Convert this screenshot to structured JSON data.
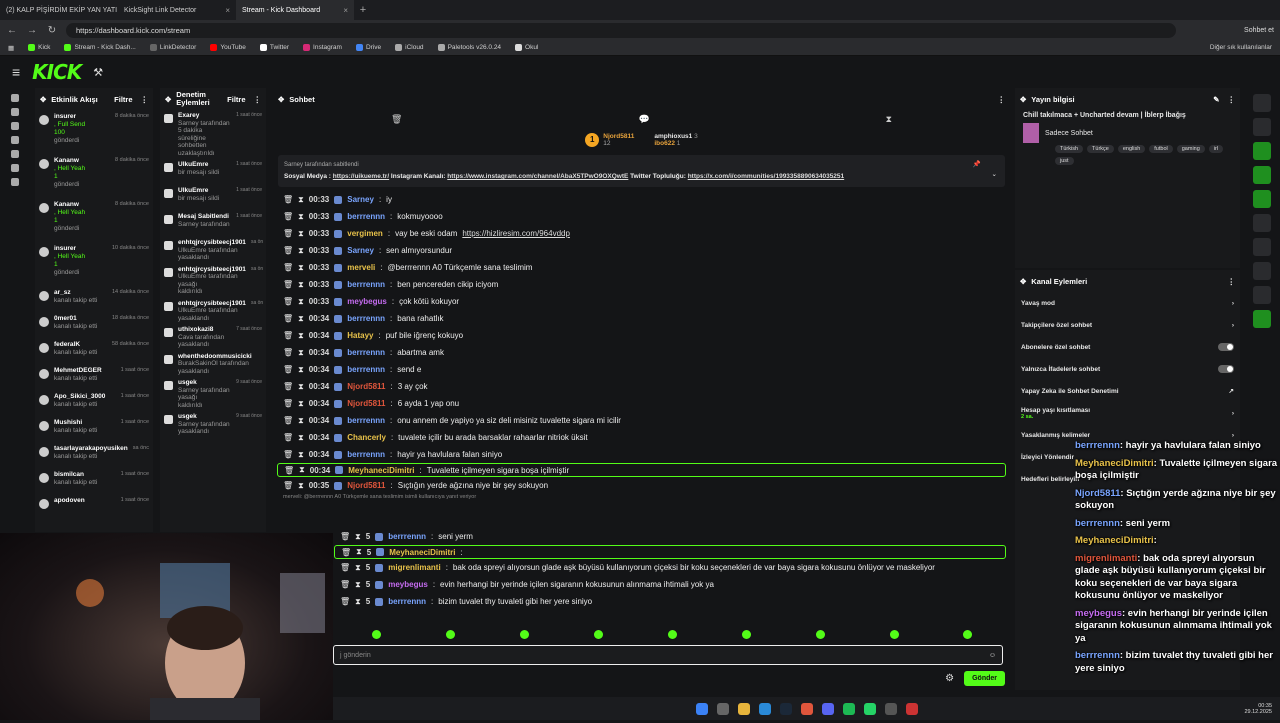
{
  "browser": {
    "tabs": [
      {
        "label": "(2) KALP PİŞİRDİM EKİP YAN YATI",
        "active": false
      },
      {
        "label": "KickSight Link Detector",
        "active": false
      },
      {
        "label": "Stream - Kick Dashboard",
        "active": true
      }
    ],
    "url": "https://dashboard.kick.com/stream",
    "profile_label": "Sohbet et",
    "bookmarks": [
      "Kick",
      "Stream - Kick Dash...",
      "LinkDetector",
      "YouTube",
      "Twitter",
      "Instagram",
      "Drive",
      "iCloud",
      "Paletools v26.0.24",
      "Okul"
    ],
    "other_bookmarks": "Diğer sık kullanılanlar"
  },
  "kick": {
    "logo": "KICK",
    "beta": "BETA"
  },
  "activity": {
    "title": "Etkinlik Akışı",
    "filter": "Filtre",
    "items": [
      {
        "name": "insurer",
        "detail": ", Full Send",
        "extra": "100",
        "action": "gönderdi",
        "time": "8 dakika önce"
      },
      {
        "name": "Kananw",
        "detail": ", Hell Yeah",
        "extra": "1",
        "action": "gönderdi",
        "time": "8 dakika önce"
      },
      {
        "name": "Kananw",
        "detail": ", Hell Yeah",
        "extra": "1",
        "action": "gönderdi",
        "time": "8 dakika önce"
      },
      {
        "name": "insurer",
        "detail": ", Hell Yeah",
        "extra": "1",
        "action": "gönderdi",
        "time": "10 dakika önce"
      },
      {
        "name": "ar_sz",
        "detail": "",
        "extra": "",
        "action": "kanalı takip etti",
        "time": "14 dakika önce"
      },
      {
        "name": "0mer01",
        "detail": "",
        "extra": "",
        "action": "kanalı takip etti",
        "time": "18 dakika önce"
      },
      {
        "name": "federalK",
        "detail": "",
        "extra": "",
        "action": "kanalı takip etti",
        "time": "58 dakika önce"
      },
      {
        "name": "MehmetDEGER",
        "detail": "",
        "extra": "",
        "action": "kanalı takip etti",
        "time": "1 saat önce"
      },
      {
        "name": "Apo_Sikici_3000",
        "detail": "",
        "extra": "",
        "action": "kanalı takip etti",
        "time": "1 saat önce"
      },
      {
        "name": "Mushishi",
        "detail": "",
        "extra": "",
        "action": "kanalı takip etti",
        "time": "1 saat önce"
      },
      {
        "name": "tasarlayarakapoyusiken",
        "detail": "",
        "extra": "",
        "action": "kanalı takip etti",
        "time": "sa önc"
      },
      {
        "name": "bismilcan",
        "detail": "",
        "extra": "",
        "action": "kanalı takip etti",
        "time": "1 saat önce"
      },
      {
        "name": "apodoven",
        "detail": "",
        "extra": "",
        "action": "",
        "time": "1 saat önce"
      }
    ]
  },
  "modlog": {
    "title": "Denetim Eylemleri",
    "filter": "Filtre",
    "items": [
      {
        "name": "Exarey",
        "line1": "Sarney tarafından 5 dakika",
        "line2": "süreliğine sohbetten uzaklaştırıldı",
        "time": "1 saat önce"
      },
      {
        "name": "UlkuEmre",
        "line1": "bir mesajı sildi",
        "line2": "",
        "time": "1 saat önce"
      },
      {
        "name": "UlkuEmre",
        "line1": "bir mesajı sildi",
        "line2": "",
        "time": "1 saat önce"
      },
      {
        "name": "Mesaj Sabitlendi",
        "line1": "Sarney tarafından",
        "line2": "",
        "time": "1 saat önce"
      },
      {
        "name": "enhtqjrcysibteecj1901",
        "line1": "UlkuEmre tarafından",
        "line2": "yasaklandı",
        "time": "sa ön"
      },
      {
        "name": "enhtqjrcysibteecj1901",
        "line1": "UlkuEmre tarafından yasağı",
        "line2": "kaldırıldı",
        "time": "sa ön"
      },
      {
        "name": "enhtqjrcysibteecj1901",
        "line1": "UlkuEmre tarafından",
        "line2": "yasaklandı",
        "time": "sa ön"
      },
      {
        "name": "uthixokazi8",
        "line1": "Cava tarafından yasaklandı",
        "line2": "",
        "time": "7 saat önce"
      },
      {
        "name": "whenthedoommusicicki",
        "line1": "BurakSakinOl tarafından",
        "line2": "yasaklandı",
        "time": ""
      },
      {
        "name": "usgek",
        "line1": "Sarney tarafından yasağı",
        "line2": "kaldırıldı",
        "time": "9 saat önce"
      },
      {
        "name": "usgek",
        "line1": "Sarney tarafından",
        "line2": "yasaklandı",
        "time": "9 saat önce"
      }
    ]
  },
  "chat": {
    "title": "Sohbet",
    "leaderboard": [
      {
        "name": "Njord5811",
        "value": "12"
      },
      {
        "name": "amphioxus1",
        "value": "3"
      },
      {
        "name": "ibo622",
        "value": "1"
      }
    ],
    "pinned": {
      "by": "Sarney tarafından sabitlendi",
      "text1": "Sosyal Medya : ",
      "link1": "https://uikueme.tr/",
      "text2": " Instagram Kanalı: ",
      "link2": "https://www.instagram.com/channel/AbaX5TPwO9OXQwtE",
      "text3": " Twitter Topluluğu: ",
      "link3": "https://x.com/i/communities/1993358890634035251"
    },
    "messages": [
      {
        "time": "00:33",
        "user": "Sarney",
        "color": "#7aa5ff",
        "text": "iy",
        "highlight": false
      },
      {
        "time": "00:33",
        "user": "berrrennn",
        "color": "#7aa5ff",
        "text": "kokmuyoooo",
        "highlight": false
      },
      {
        "time": "00:33",
        "user": "vergimen",
        "color": "#e8c24a",
        "text": "vay be eski odam ",
        "link": "https://hizliresim.com/964vddp",
        "highlight": false
      },
      {
        "time": "00:33",
        "user": "Sarney",
        "color": "#7aa5ff",
        "text": "sen almıyorsundur",
        "highlight": false
      },
      {
        "time": "00:33",
        "user": "merveli",
        "color": "#e8c24a",
        "text": "@berrrennn A0 Türkçemle sana teslimim",
        "highlight": false
      },
      {
        "time": "00:33",
        "user": "berrrennn",
        "color": "#7aa5ff",
        "text": "ben pencereden cikip iciyom",
        "highlight": false
      },
      {
        "time": "00:33",
        "user": "meybegus",
        "color": "#c56cf0",
        "text": "çok kötü kokuyor",
        "highlight": false
      },
      {
        "time": "00:34",
        "user": "berrrennn",
        "color": "#7aa5ff",
        "text": "bana rahatlık",
        "highlight": false
      },
      {
        "time": "00:34",
        "user": "Hatayy",
        "color": "#e8c24a",
        "text": "puf bile iğrenç kokuyo",
        "highlight": false
      },
      {
        "time": "00:34",
        "user": "berrrennn",
        "color": "#7aa5ff",
        "text": "abartma amk",
        "highlight": false
      },
      {
        "time": "00:34",
        "user": "berrrennn",
        "color": "#7aa5ff",
        "text": "send e",
        "highlight": false
      },
      {
        "time": "00:34",
        "user": "Njord5811",
        "color": "#e0563c",
        "text": "3 ay çok",
        "highlight": false
      },
      {
        "time": "00:34",
        "user": "Njord5811",
        "color": "#e0563c",
        "text": "6 ayda 1 yap onu",
        "highlight": false
      },
      {
        "time": "00:34",
        "user": "berrrennn",
        "color": "#7aa5ff",
        "text": "onu annem de yapiyo ya siz deli misiniz tuvalette sigara mi icilir",
        "highlight": false
      },
      {
        "time": "00:34",
        "user": "Chancerly",
        "color": "#e8c24a",
        "text": "tuvalete içilir bu arada barsaklar rahaarlar nitriok üksit",
        "highlight": false
      },
      {
        "time": "00:34",
        "user": "berrrennn",
        "color": "#7aa5ff",
        "text": "hayir ya havlulara falan siniyo",
        "highlight": false
      },
      {
        "time": "00:34",
        "user": "MeyhaneciDimitri",
        "color": "#e8c24a",
        "text": "Tuvalette içilmeyen sigara boşa içilmiştir",
        "highlight": true
      },
      {
        "time": "00:35",
        "user": "Njord5811",
        "color": "#e0563c",
        "text": "Sıçtığın yerde ağzına niye bir şey sokuyon",
        "highlight": false
      }
    ],
    "reply_note": "merveli: @berrrennn A0 Türkçemle sana teslimim isimli kullanıcıya yanıt veriyor",
    "late_messages": [
      {
        "time": "5",
        "user": "berrrennn",
        "color": "#7aa5ff",
        "text": "seni yerm",
        "highlight": false
      },
      {
        "time": "5",
        "user": "MeyhaneciDimitri",
        "color": "#e8c24a",
        "text": "",
        "highlight": true
      },
      {
        "time": "5",
        "user": "migrenlimanti",
        "color": "#e8c24a",
        "text": "bak oda spreyi alıyorsun glade aşk büyüsü kullanıyorum çiçeksi bir koku seçenekleri de var baya sigara kokusunu önlüyor ve maskeliyor",
        "highlight": false
      },
      {
        "time": "5",
        "user": "meybegus",
        "color": "#c56cf0",
        "text": "evin herhangi bir yerinde içilen sigaranın kokusunun alınmama ihtimali yok ya",
        "highlight": false
      },
      {
        "time": "5",
        "user": "berrrennn",
        "color": "#7aa5ff",
        "text": "bizim tuvalet thy tuvaleti gibi her yere siniyo",
        "highlight": false
      }
    ],
    "input_placeholder": "j gönderin",
    "send": "Gönder"
  },
  "stream_info": {
    "title": "Yayın bilgisi",
    "stream_title": "Chill takılmaca + Uncharted devam | İblerp İbağış",
    "category": "Sadece Sohbet",
    "tags": [
      "Türkish",
      "Türkçe",
      "english",
      "futbol",
      "gaming",
      "irl",
      "just"
    ]
  },
  "channel_actions": {
    "title": "Kanal Eylemleri",
    "rows": [
      {
        "label": "Yavaş mod",
        "control": "chevron"
      },
      {
        "label": "Takipçilere özel sohbet",
        "control": "chevron"
      },
      {
        "label": "Abonelere özel sohbet",
        "control": "toggle"
      },
      {
        "label": "Yalnızca İfadelerle sohbet",
        "control": "toggle"
      },
      {
        "label": "Yapay Zeka ile Sohbet Denetimi",
        "control": "link"
      },
      {
        "label": "Hesap yaşı kısıtlaması",
        "sub": "2 sa.",
        "control": "chevron"
      },
      {
        "label": "Yasaklanmış kelimeler",
        "control": "chevron"
      },
      {
        "label": "İzleyici Yönlendir",
        "control": ""
      },
      {
        "label": "Hedefleri belirleyin",
        "control": ""
      }
    ]
  },
  "overlay": [
    {
      "user": "berrrennn",
      "color": "#7aa5ff",
      "text": ": hayir ya havlulara falan siniyo"
    },
    {
      "user": "MeyhaneciDimitri",
      "color": "#e8c24a",
      "text": ": Tuvalette içilmeyen sigara boşa içilmiştir"
    },
    {
      "user": "Njord5811",
      "color": "#7aa5ff",
      "text": ": Sıçtığın yerde ağzına niye bir şey sokuyon"
    },
    {
      "user": "berrrennn",
      "color": "#7aa5ff",
      "text": ": seni yerm"
    },
    {
      "user": "MeyhaneciDimitri",
      "color": "#e8c24a",
      "text": ":"
    },
    {
      "user": "migrenlimanti",
      "color": "#e0563c",
      "text": ": bak oda spreyi alıyorsun glade aşk büyüsü kullanıyorum çiçeksi bir koku seçenekleri de var baya sigara kokusunu önlüyor ve maskeliyor"
    },
    {
      "user": "meybegus",
      "color": "#c56cf0",
      "text": ": evin herhangi bir yerinde içilen sigaranın kokusunun alınmama ihtimali yok ya"
    },
    {
      "user": "berrrennn",
      "color": "#7aa5ff",
      "text": ": bizim tuvalet thy tuvaleti gibi her yere siniyo"
    }
  ],
  "taskbar": {
    "time": "00:35",
    "date": "29.12.2025"
  }
}
